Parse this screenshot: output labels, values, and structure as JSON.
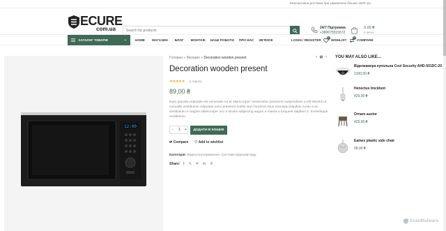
{
  "topbar": {
    "promo": "Безкоштовна доставка при замовленні більше 1500 грн"
  },
  "header": {
    "logo_main": "ECURE",
    "logo_sub": "com.ua",
    "search_placeholder": "Search for products",
    "support_title": "24/7 Підтримка",
    "support_phone": "+380675515572",
    "cart_total": "0,00 ₴",
    "cart_items": "0 items"
  },
  "nav": {
    "categories_label": "КАТАЛОГ ТОВАРІВ",
    "menu": [
      "HOME",
      "МАГАЗИН",
      "БЛОГ",
      "МОНТАЖ",
      "НАШІ РОБОТИ",
      "ПРО НАС",
      "ЗВ'ЯЗОК"
    ],
    "login": "LOGIN / REGISTER",
    "wishlist": "WISHLIST",
    "wishlist_count": "0",
    "compare": "COMPARE",
    "compare_count": "0"
  },
  "product": {
    "breadcrumb_home": "Головна",
    "breadcrumb_shop": "Магазин",
    "breadcrumb_current": "Decoration wooden present",
    "title": "Decoration wooden present",
    "stars": "★★★★★",
    "rating": 5,
    "reviews": "(1 відгук)",
    "price": "89,00 ₴",
    "description": "Nam gravida vulputate est venenatis eu at ullamcorper consectetur parturient suspendisse a elit lobortis ut convallis vestibulum vulputate nunc praesent mattis sem faucibus risus sociosqu.Dapibus curae a ac vestibulum a magnis ullamcorper orci a iaculis adipiscing augue a massa a torquent dapibus a. Scelerisque vestibulum.",
    "qty_minus": "-",
    "qty_value": "1",
    "qty_plus": "+",
    "add_to_cart": "ДОДАТИ В КОШИК",
    "compare": "Compare",
    "wishlist": "Add to wishlist",
    "category_label": "Категорія:",
    "category_value": "Відеоспостереження. Системи відеонагляду",
    "share_label": "Share:",
    "social": [
      "f",
      "𝕏",
      "℗",
      "in",
      "✆"
    ]
  },
  "related": {
    "heading": "YOU MAY ALSO LIKE…",
    "items": [
      {
        "name": "Відеокамера купольна Covi Security AHD-501DC-20",
        "price": "1330,00 ₴"
      },
      {
        "name": "Henectus tincidunt",
        "price": "429,00 ₴"
      },
      {
        "name": "Ornare auctor",
        "price": "429,00 ₴"
      },
      {
        "name": "Eames plastic side chair",
        "price": "99,00 ₴"
      }
    ]
  },
  "watermark": "ScanMalware",
  "colors": {
    "accent": "#3f6a55",
    "stars": "#f5a623"
  }
}
